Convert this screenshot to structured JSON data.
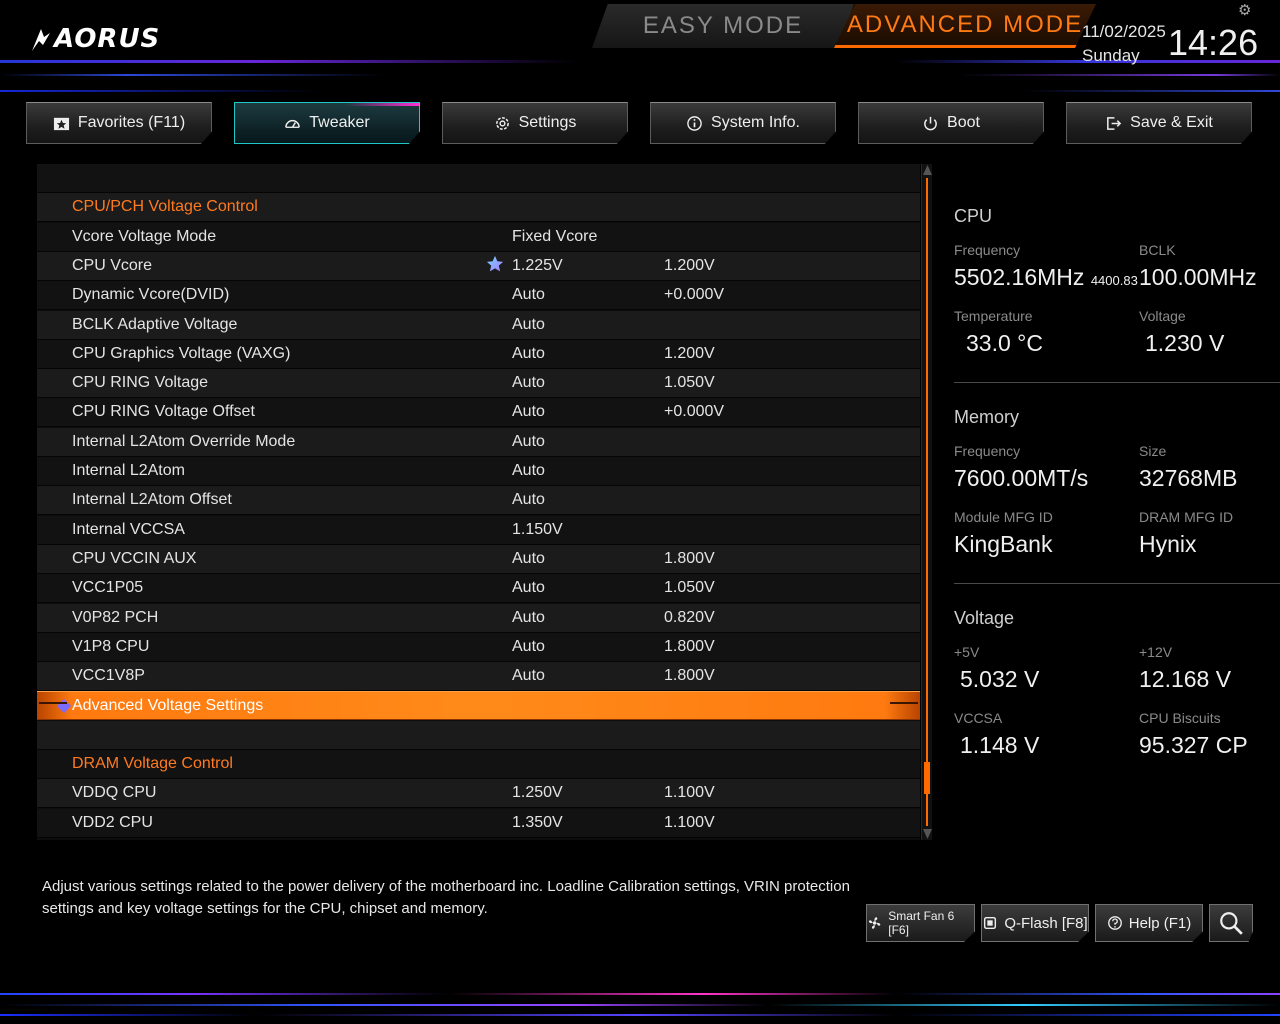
{
  "brand": {
    "logo": "AORUS"
  },
  "header": {
    "easy_mode": "EASY MODE",
    "advanced_mode": "ADVANCED MODE",
    "date": "11/02/2025",
    "day": "Sunday",
    "time": "14:26"
  },
  "tabs": [
    {
      "label": "Favorites (F11)",
      "icon": "star-box-icon"
    },
    {
      "label": "Tweaker",
      "icon": "speedometer-icon",
      "active": true
    },
    {
      "label": "Settings",
      "icon": "gear-icon"
    },
    {
      "label": "System Info.",
      "icon": "info-icon"
    },
    {
      "label": "Boot",
      "icon": "power-icon"
    },
    {
      "label": "Save & Exit",
      "icon": "exit-icon"
    }
  ],
  "rows": [
    {
      "type": "blank"
    },
    {
      "type": "section",
      "label": "CPU/PCH Voltage Control"
    },
    {
      "label": "Vcore Voltage Mode",
      "value": "Fixed Vcore",
      "current": ""
    },
    {
      "label": "CPU Vcore",
      "value": "1.225V",
      "current": "1.200V",
      "favorite": true
    },
    {
      "label": "Dynamic Vcore(DVID)",
      "value": "Auto",
      "current": "+0.000V"
    },
    {
      "label": "BCLK Adaptive Voltage",
      "value": "Auto",
      "current": ""
    },
    {
      "label": "CPU Graphics Voltage (VAXG)",
      "value": "Auto",
      "current": "1.200V"
    },
    {
      "label": "CPU RING Voltage",
      "value": "Auto",
      "current": "1.050V"
    },
    {
      "label": "CPU RING Voltage Offset",
      "value": "Auto",
      "current": "+0.000V"
    },
    {
      "label": "Internal L2Atom Override Mode",
      "value": "Auto",
      "current": ""
    },
    {
      "label": "Internal L2Atom",
      "value": "Auto",
      "current": ""
    },
    {
      "label": "Internal L2Atom Offset",
      "value": "Auto",
      "current": ""
    },
    {
      "label": "Internal VCCSA",
      "value": "1.150V",
      "current": ""
    },
    {
      "label": "CPU VCCIN AUX",
      "value": "Auto",
      "current": "1.800V"
    },
    {
      "label": "VCC1P05",
      "value": "Auto",
      "current": "1.050V"
    },
    {
      "label": "V0P82 PCH",
      "value": "Auto",
      "current": "0.820V"
    },
    {
      "label": "V1P8 CPU",
      "value": "Auto",
      "current": "1.800V"
    },
    {
      "label": "VCC1V8P",
      "value": "Auto",
      "current": "1.800V"
    },
    {
      "type": "highlight",
      "label": "Advanced Voltage Settings"
    },
    {
      "type": "blank"
    },
    {
      "type": "section",
      "label": "DRAM Voltage Control"
    },
    {
      "label": "VDDQ CPU",
      "value": "1.250V",
      "current": "1.100V"
    },
    {
      "label": "VDD2 CPU",
      "value": "1.350V",
      "current": "1.100V"
    }
  ],
  "cpu": {
    "title": "CPU",
    "frequency_label": "Frequency",
    "frequency": "5502.16MHz",
    "frequency_sub": "4400.83",
    "bclk_label": "BCLK",
    "bclk": "100.00MHz",
    "temperature_label": "Temperature",
    "temperature": "33.0 °C",
    "voltage_label": "Voltage",
    "voltage": "1.230 V"
  },
  "memory": {
    "title": "Memory",
    "frequency_label": "Frequency",
    "frequency": "7600.00MT/s",
    "size_label": "Size",
    "size": "32768MB",
    "module_label": "Module MFG ID",
    "module": "KingBank",
    "dram_label": "DRAM MFG ID",
    "dram": "Hynix"
  },
  "voltage": {
    "title": "Voltage",
    "v5_label": "+5V",
    "v5": "5.032 V",
    "v12_label": "+12V",
    "v12": "12.168 V",
    "vccsa_label": "VCCSA",
    "vccsa": "1.148 V",
    "biscuits_label": "CPU Biscuits",
    "biscuits": "95.327 CP"
  },
  "footer": {
    "description": "Adjust various settings related to the power delivery of the motherboard inc. Loadline Calibration settings, VRIN protection settings and key voltage settings for the CPU, chipset and memory.",
    "smart_fan": "Smart Fan 6 [F6]",
    "qflash": "Q-Flash [F8]",
    "help": "Help (F1)"
  },
  "colors": {
    "accent": "#ff6a00",
    "active_tab": "#1fc7c7",
    "magenta": "#ff2fd4"
  }
}
